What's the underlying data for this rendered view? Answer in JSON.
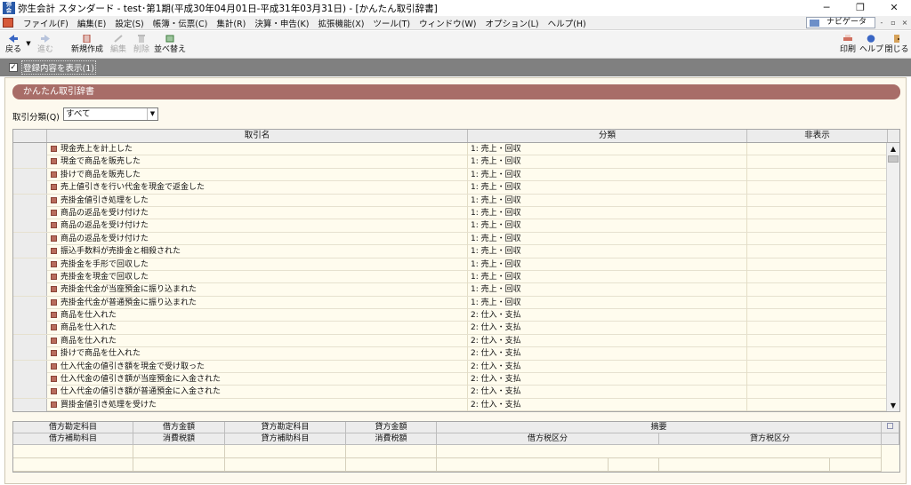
{
  "window": {
    "icon_text": "弥生\n会計",
    "title": "弥生会計 スタンダード - test･第1期(平成30年04月01日-平成31年03月31日) - [かんたん取引辞書]",
    "minimize": "─",
    "maximize": "❐",
    "close": "✕"
  },
  "menu": {
    "items": [
      "ファイル(F)",
      "編集(E)",
      "設定(S)",
      "帳簿・伝票(C)",
      "集計(R)",
      "決算・申告(K)",
      "拡張機能(X)",
      "ツール(T)",
      "ウィンドウ(W)",
      "オプション(L)",
      "ヘルプ(H)"
    ],
    "navigator": "ナビゲータ",
    "mdi_min": "-",
    "mdi_restore": "▫",
    "mdi_close": "×"
  },
  "toolbar": {
    "back": "戻る",
    "forward": "進む",
    "new": "新規作成",
    "edit": "編集",
    "delete": "削除",
    "sort": "並べ替え",
    "print": "印刷",
    "help": "ヘルプ",
    "close": "閉じる"
  },
  "options": {
    "show_registered": "登録内容を表示(1)",
    "checked": "✓"
  },
  "panel": {
    "title": "かんたん取引辞書",
    "filter_label": "取引分類(Q)",
    "filter_value": "すべて",
    "filter_arrow": "▼"
  },
  "grid": {
    "columns": [
      "取引名",
      "分類",
      "非表示"
    ],
    "rows": [
      {
        "name": "現金売上を計上した",
        "category": "1: 売上・回収"
      },
      {
        "name": "現金で商品を販売した",
        "category": "1: 売上・回収"
      },
      {
        "name": "掛けで商品を販売した",
        "category": "1: 売上・回収"
      },
      {
        "name": "売上値引きを行い代金を現金で返金した",
        "category": "1: 売上・回収"
      },
      {
        "name": "売掛金値引き処理をした",
        "category": "1: 売上・回収"
      },
      {
        "name": "商品の返品を受け付けた",
        "category": "1: 売上・回収"
      },
      {
        "name": "商品の返品を受け付けた",
        "category": "1: 売上・回収"
      },
      {
        "name": "商品の返品を受け付けた",
        "category": "1: 売上・回収"
      },
      {
        "name": "振込手数料が売掛金と相殺された",
        "category": "1: 売上・回収"
      },
      {
        "name": "売掛金を手形で回収した",
        "category": "1: 売上・回収"
      },
      {
        "name": "売掛金を現金で回収した",
        "category": "1: 売上・回収"
      },
      {
        "name": "売掛金代金が当座預金に振り込まれた",
        "category": "1: 売上・回収"
      },
      {
        "name": "売掛金代金が普通預金に振り込まれた",
        "category": "1: 売上・回収"
      },
      {
        "name": "商品を仕入れた",
        "category": "2: 仕入・支払"
      },
      {
        "name": "商品を仕入れた",
        "category": "2: 仕入・支払"
      },
      {
        "name": "商品を仕入れた",
        "category": "2: 仕入・支払"
      },
      {
        "name": "掛けで商品を仕入れた",
        "category": "2: 仕入・支払"
      },
      {
        "name": "仕入代金の値引き額を現金で受け取った",
        "category": "2: 仕入・支払"
      },
      {
        "name": "仕入代金の値引き額が当座預金に入金された",
        "category": "2: 仕入・支払"
      },
      {
        "name": "仕入代金の値引き額が普通預金に入金された",
        "category": "2: 仕入・支払"
      },
      {
        "name": "買掛金値引き処理を受けた",
        "category": "2: 仕入・支払"
      }
    ],
    "scroll_up": "▲",
    "scroll_down": "▼"
  },
  "journal": {
    "row1": [
      "借方勘定科目",
      "借方金額",
      "貸方勘定科目",
      "貸方金額",
      "摘要"
    ],
    "row2": [
      "借方補助科目",
      "消費税額",
      "貸方補助科目",
      "消費税額",
      "借方税区分",
      "貸方税区分"
    ]
  }
}
